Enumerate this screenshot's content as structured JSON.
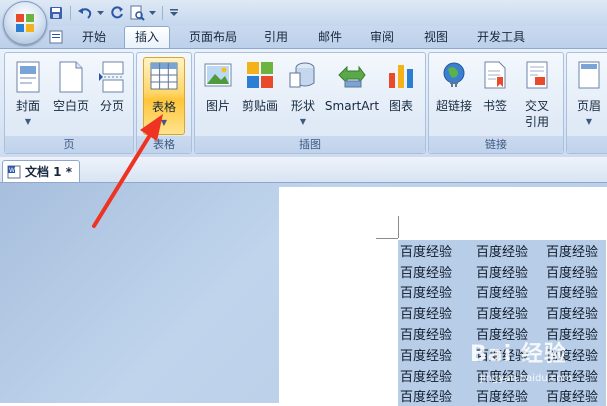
{
  "quick_access": {
    "icons": [
      "save-icon",
      "undo-icon",
      "redo-icon",
      "print-preview-icon",
      "customize-icon"
    ]
  },
  "tabs": [
    {
      "label": "开始",
      "active": false
    },
    {
      "label": "插入",
      "active": true
    },
    {
      "label": "页面布局",
      "active": false
    },
    {
      "label": "引用",
      "active": false
    },
    {
      "label": "邮件",
      "active": false
    },
    {
      "label": "审阅",
      "active": false
    },
    {
      "label": "视图",
      "active": false
    },
    {
      "label": "开发工具",
      "active": false
    }
  ],
  "ribbon": {
    "groups": {
      "pages": {
        "label": "页",
        "buttons": [
          "封面",
          "空白页",
          "分页"
        ]
      },
      "table": {
        "label": "表格",
        "button": "表格"
      },
      "illustrations": {
        "label": "插图",
        "buttons": [
          "图片",
          "剪贴画",
          "形状",
          "SmartArt",
          "图表"
        ]
      },
      "links": {
        "label": "链接",
        "buttons": [
          "超链接",
          "书签",
          "交叉",
          "引用"
        ]
      },
      "header": {
        "buttons": [
          "页眉"
        ]
      }
    }
  },
  "document": {
    "tab_label": "文档 1 *",
    "table_rows": [
      [
        "百度经验",
        "百度经验",
        "百度经验"
      ],
      [
        "百度经验",
        "百度经验",
        "百度经验"
      ],
      [
        "百度经验",
        "百度经验",
        "百度经验"
      ],
      [
        "百度经验",
        "百度经验",
        "百度经验"
      ],
      [
        "百度经验",
        "百度经验",
        "百度经验"
      ],
      [
        "百度经验",
        "百度经验",
        "百度经验"
      ],
      [
        "百度经验",
        "百度经验",
        "百度经验"
      ],
      [
        "百度经验",
        "百度经验",
        "百度经验"
      ]
    ]
  },
  "watermark": {
    "text": "Bai 经验",
    "url": "jingyan.baidu.com"
  },
  "colors": {
    "annotation_arrow": "#ee3322",
    "highlight": "#ffd76b",
    "table_fill": "#b8cde7"
  }
}
